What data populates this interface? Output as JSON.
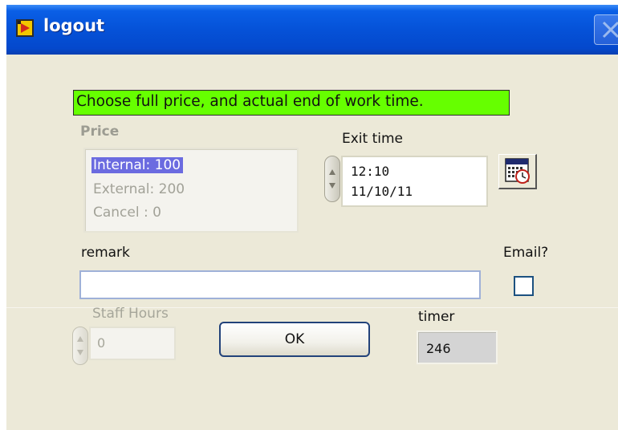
{
  "window": {
    "title": "logout",
    "icon": "labview-vi-icon",
    "close_icon": "close-icon"
  },
  "banner": {
    "text": "Choose full price, and actual end of work time.",
    "color": "#66ff00"
  },
  "price": {
    "label": "Price",
    "items": [
      {
        "label": "Internal: 100",
        "selected": true
      },
      {
        "label": "External:  200",
        "selected": false
      },
      {
        "label": "Cancel : 0",
        "selected": false
      }
    ]
  },
  "exit_time": {
    "label": "Exit time",
    "time": "12:10",
    "date": "11/10/11",
    "calendar_icon": "calendar-clock-icon"
  },
  "remark": {
    "label": "remark",
    "value": ""
  },
  "email": {
    "label": "Email?",
    "checked": false
  },
  "staff_hours": {
    "label": "Staff Hours",
    "value": "0"
  },
  "ok_button": {
    "label": "OK"
  },
  "timer": {
    "label": "timer",
    "value": "246"
  }
}
